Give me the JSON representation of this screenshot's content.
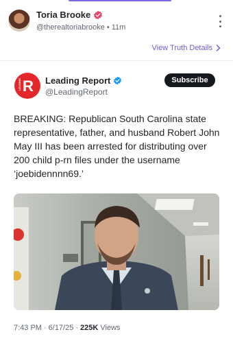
{
  "header": {
    "name": "Toria Brooke",
    "handle": "@therealtoriabrooke",
    "separator": "•",
    "time": "11m",
    "verified_color": "#e6446b"
  },
  "truth_link": {
    "label": "View Truth Details",
    "icon": "chevron-right-icon"
  },
  "quoted_post": {
    "logo_letter": "R",
    "logo_side_text": "LEADING",
    "logo_color": "#e3282b",
    "author": "Leading Report",
    "handle": "@LeadingReport",
    "verified_color": "#1d9bf0",
    "subscribe_label": "Subscribe",
    "text": "BREAKING: Republican South Carolina state representative, father, and husband Robert John May III has been arrested for distributing over 200 child p-rn files under the username ‘joebidennnn69.’",
    "media_description_icon": "photo"
  },
  "footer": {
    "time": "7:43 PM",
    "sep1": "·",
    "date": "6/17/25",
    "sep2": "·",
    "views_count": "225K",
    "views_label": "Views"
  },
  "colors": {
    "accent": "#6b5bd6",
    "subscribe_bg": "#15181c",
    "muted_text": "#5f6673"
  }
}
